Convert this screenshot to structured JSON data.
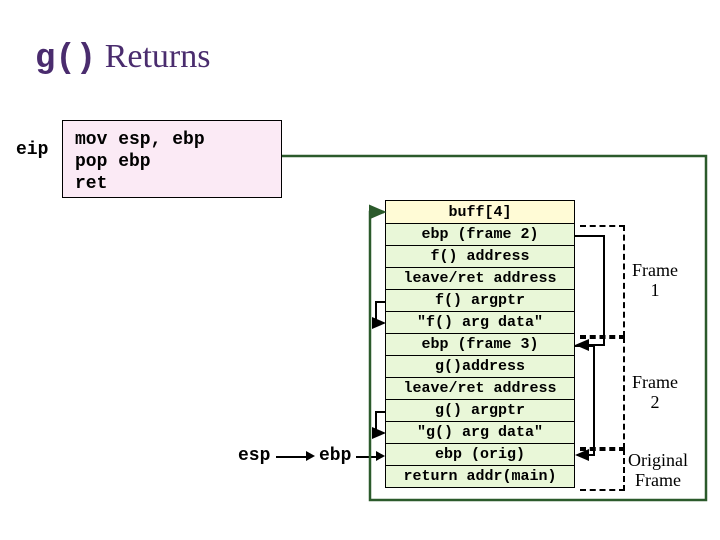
{
  "title": {
    "prefix": "g()",
    "word": "Returns"
  },
  "eip_label": "eip",
  "code": "mov esp, ebp\npop ebp\nret",
  "stack": [
    "buff[4]",
    "ebp (frame 2)",
    "f() address",
    "leave/ret address",
    "f() argptr",
    "\"f() arg data\"",
    "ebp (frame 3)",
    "g()address",
    "leave/ret address",
    "g() argptr",
    "\"g() arg data\"",
    "ebp (orig)",
    "return addr(main)"
  ],
  "reg_esp": "esp",
  "reg_ebp": "ebp",
  "frames": {
    "f1": "Frame\n1",
    "f2": "Frame\n2",
    "orig": "Original\nFrame"
  },
  "colors": {
    "title": "#4a2c6e",
    "codebg": "#fbeaf5",
    "buffbg": "#fffbd6",
    "cellbg": "#e9f7d8",
    "dark_arrow": "#2b5a2b"
  }
}
